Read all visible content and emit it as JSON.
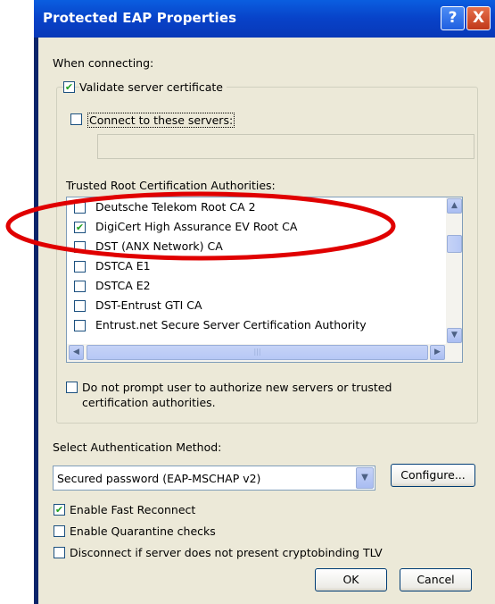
{
  "window": {
    "title": "Protected EAP Properties",
    "help_glyph": "?",
    "close_glyph": "X"
  },
  "connecting": {
    "label": "When connecting:",
    "validate": {
      "label": "Validate server certificate",
      "checked": true
    },
    "connect_servers": {
      "label": "Connect to these servers:",
      "checked": false,
      "value": ""
    },
    "trusted_label": "Trusted Root Certification Authorities:",
    "ca_list": [
      {
        "label": "Deutsche Telekom Root CA 2",
        "checked": false
      },
      {
        "label": "DigiCert High Assurance EV Root CA",
        "checked": true
      },
      {
        "label": "DST (ANX Network) CA",
        "checked": false
      },
      {
        "label": "DSTCA E1",
        "checked": false
      },
      {
        "label": "DSTCA E2",
        "checked": false
      },
      {
        "label": "DST-Entrust GTI CA",
        "checked": false
      },
      {
        "label": "Entrust.net Secure Server Certification Authority",
        "checked": false
      }
    ],
    "no_prompt": {
      "line1": "Do not prompt user to authorize new servers or trusted",
      "line2": "certification authorities.",
      "checked": false
    }
  },
  "auth": {
    "label": "Select Authentication Method:",
    "selected": "Secured password (EAP-MSCHAP v2)",
    "configure_label": "Configure..."
  },
  "options": {
    "fast_reconnect": {
      "label": "Enable Fast Reconnect",
      "checked": true
    },
    "quarantine": {
      "label": "Enable Quarantine checks",
      "checked": false
    },
    "cryptobinding": {
      "label": "Disconnect if server does not present cryptobinding TLV",
      "checked": false
    }
  },
  "buttons": {
    "ok": "OK",
    "cancel": "Cancel"
  },
  "colors": {
    "annotation": "#e00000",
    "titlebar": "#0842c8",
    "dialog_bg": "#ece9d8",
    "check": "#21a121"
  }
}
